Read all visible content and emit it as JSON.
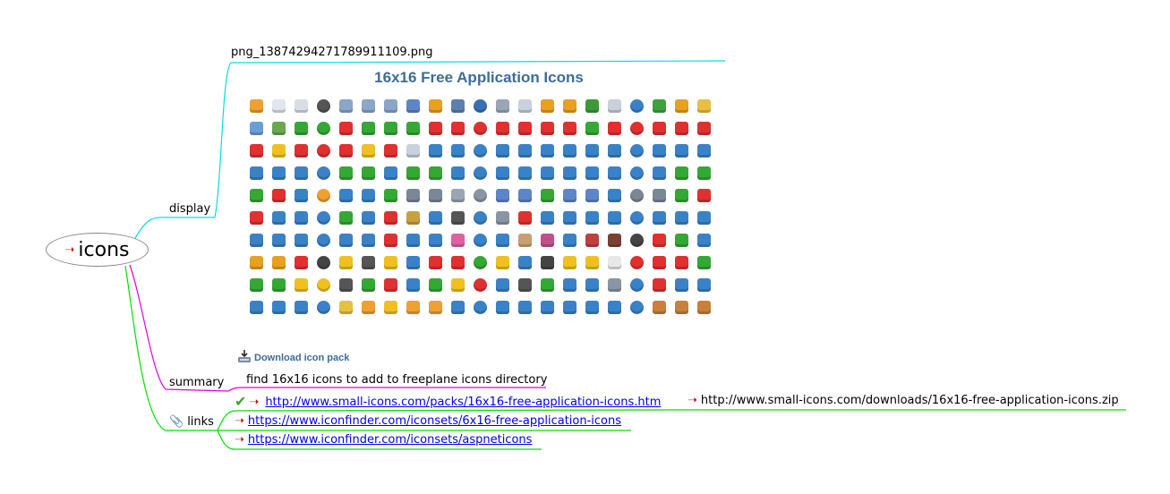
{
  "root": {
    "label": "icons"
  },
  "display": {
    "label": "display",
    "filename": "png_13874294271789911109.png",
    "panel_title": "16x16 Free Application Icons",
    "download_label": "Download icon pack",
    "icon_colors": [
      "#f0a030",
      "#dfe6ee",
      "#d9dee6",
      "#555555",
      "#8aa6c8",
      "#8aa6c8",
      "#8aa6c8",
      "#5d86c8",
      "#e8a020",
      "#5d7fb0",
      "#3a6fb5",
      "#9aa6b4",
      "#c9d1dc",
      "#e8a020",
      "#e8a020",
      "#3a9a3a",
      "#c9d1dc",
      "#3a82c8",
      "#40a040",
      "#e8a020",
      "#e8c040",
      "#6a9ed8",
      "#6aa84f",
      "#34a834",
      "#34a834",
      "#e03030",
      "#34a834",
      "#34a834",
      "#34a834",
      "#e03030",
      "#e03030",
      "#e03030",
      "#e03030",
      "#e03030",
      "#e03030",
      "#e03030",
      "#34a834",
      "#e03030",
      "#e03030",
      "#e03030",
      "#e03030",
      "#e03030",
      "#e03030",
      "#f0c020",
      "#e03030",
      "#e03030",
      "#e03030",
      "#f0c020",
      "#e03030",
      "#c9d1dc",
      "#3a82c8",
      "#3a82c8",
      "#3a82c8",
      "#3a82c8",
      "#3a82c8",
      "#3a82c8",
      "#3a82c8",
      "#3a82c8",
      "#3a82c8",
      "#3a82c8",
      "#3a82c8",
      "#3a82c8",
      "#3a82c8",
      "#3a82c8",
      "#3a82c8",
      "#3a82c8",
      "#3a82c8",
      "#34a834",
      "#34a834",
      "#3a82c8",
      "#34a834",
      "#34a834",
      "#3a82c8",
      "#3a82c8",
      "#3a82c8",
      "#3a82c8",
      "#3a82c8",
      "#3a82c8",
      "#3a82c8",
      "#3a82c8",
      "#3a82c8",
      "#3a82c8",
      "#34a834",
      "#34a834",
      "#34a834",
      "#e03030",
      "#3a82c8",
      "#f0a030",
      "#3a82c8",
      "#3a82c8",
      "#34a834",
      "#7a8896",
      "#7a8896",
      "#9aa6b4",
      "#8a95a3",
      "#5d86c8",
      "#5d86c8",
      "#34a834",
      "#5d86c8",
      "#5d86c8",
      "#3a82c8",
      "#7a8896",
      "#7a8896",
      "#34a834",
      "#e03030",
      "#e03030",
      "#3a82c8",
      "#3a82c8",
      "#3a82c8",
      "#34a834",
      "#3a82c8",
      "#e03030",
      "#c8a040",
      "#3a82c8",
      "#555555",
      "#3a82c8",
      "#8a95a3",
      "#e03030",
      "#3a82c8",
      "#3a82c8",
      "#3a82c8",
      "#3a82c8",
      "#3a82c8",
      "#3a82c8",
      "#3a82c8",
      "#3a82c8",
      "#3a82c8",
      "#3a82c8",
      "#3a82c8",
      "#3a82c8",
      "#3a82c8",
      "#3a82c8",
      "#e03030",
      "#3a82c8",
      "#3a82c8",
      "#e060a0",
      "#3a82c8",
      "#3a82c8",
      "#c8a070",
      "#c0508a",
      "#3a82c8",
      "#c04040",
      "#7a4030",
      "#444444",
      "#e03030",
      "#34a834",
      "#3a82c8",
      "#e8a020",
      "#e8a020",
      "#e03030",
      "#444444",
      "#f0c020",
      "#555555",
      "#f0c020",
      "#3a82c8",
      "#e03030",
      "#e03030",
      "#34a834",
      "#f0c020",
      "#3a82c8",
      "#444444",
      "#f0c020",
      "#f0c020",
      "#e8e8e8",
      "#e03030",
      "#e03030",
      "#e03030",
      "#34a834",
      "#34a834",
      "#34a834",
      "#f0c020",
      "#f0c020",
      "#555555",
      "#34a834",
      "#e03030",
      "#3a82c8",
      "#34a834",
      "#f0c020",
      "#e03030",
      "#3a82c8",
      "#555555",
      "#34a834",
      "#3a82c8",
      "#3a82c8",
      "#8a95a3",
      "#3a82c8",
      "#e03030",
      "#3a82c8",
      "#3a82c8",
      "#3a82c8",
      "#3a82c8",
      "#3a82c8",
      "#3a82c8",
      "#e8c040",
      "#f0a030",
      "#f0c020",
      "#f0a030",
      "#f0a030",
      "#3a82c8",
      "#3a82c8",
      "#3a82c8",
      "#3a82c8",
      "#3a82c8",
      "#3a82c8",
      "#3a82c8",
      "#3a82c8",
      "#3a82c8",
      "#c8803a",
      "#c8803a",
      "#c8803a"
    ]
  },
  "summary": {
    "label": "summary",
    "text": "find 16x16 icons to add to freeplane icons directory"
  },
  "links": {
    "label": "links",
    "items": [
      {
        "url": "http://www.small-icons.com/packs/16x16-free-application-icons.htm"
      },
      {
        "url": "https://www.iconfinder.com/iconsets/6x16-free-application-icons"
      },
      {
        "url": "https://www.iconfinder.com/iconsets/aspneticons"
      }
    ],
    "child_url": "http://www.small-icons.com/downloads/16x16-free-application-icons.zip"
  },
  "colors": {
    "display_edge": "#00e0e0",
    "summary_edge": "#e000e0",
    "links_edge": "#00e000",
    "title": "#3d6c99",
    "link": "#0000ee",
    "arrow": "#d00000"
  }
}
